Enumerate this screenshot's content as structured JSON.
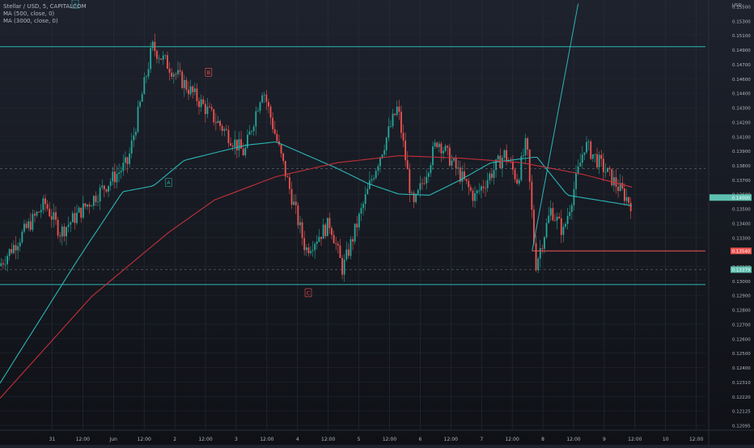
{
  "legend": {
    "symbol": "Stellar / USD, 5, CAPITALCOM",
    "ma1": "MA (500, close, 0)",
    "ma2": "MA (3000, close, 0)"
  },
  "flag_label": "1",
  "colors": {
    "up": "#26a69a",
    "down": "#ef5350",
    "ma500": "#2cb6b6",
    "ma3000": "#c2303a",
    "level": "#2cb6b6",
    "price_tag": "#5fbfb0",
    "bg": "#1e222d",
    "axis_text": "#b2b5be"
  },
  "chart_data": {
    "type": "candlestick",
    "title": "Stellar / USD, 5, CAPITALCOM",
    "ylabel": "USD",
    "ylim": [
      0.11995,
      0.15702
    ],
    "x_ticks": [
      "31",
      "12:00",
      "Jun",
      "12:00",
      "2",
      "12:00",
      "3",
      "12:00",
      "4",
      "12:00",
      "5",
      "12:00",
      "6",
      "12:00",
      "7",
      "12:00",
      "8",
      "12:00",
      "9",
      "12:00",
      "10",
      "12:00"
    ],
    "y_ticks": [
      "0.15500",
      "0.15300",
      "0.15100",
      "0.14900",
      "0.14700",
      "0.14600",
      "0.14400",
      "0.14300",
      "0.14200",
      "0.14100",
      "0.13900",
      "0.13800",
      "0.13700",
      "0.13600",
      "0.13500",
      "0.13400",
      "0.13300",
      "0.13200",
      "0.13100",
      "0.13000",
      "0.12900",
      "0.12800",
      "0.12700",
      "0.12600",
      "0.12500",
      "0.12400",
      "0.12310",
      "0.12220",
      "0.12125",
      "0.12095"
    ],
    "price_labels": [
      {
        "text": "0.13540",
        "value": 0.1354,
        "color": "#ef5350"
      },
      {
        "text": "0.13379",
        "value": 0.13379,
        "color": "#5fbfb0"
      },
      {
        "text": "0.14000",
        "value": 0.14,
        "color": "#5fbfb0"
      }
    ],
    "horizontal_levels": [
      0.153,
      0.1325
    ],
    "dashed_levels": [
      0.1425,
      0.1338
    ],
    "wave_labels": [
      {
        "text": "B",
        "color": "#ef5350"
      },
      {
        "text": "A",
        "color": "#26a69a"
      },
      {
        "text": "C",
        "color": "#ef5350"
      }
    ],
    "price_path_index": [
      0,
      1.5,
      2,
      4.2,
      5,
      8,
      8.6,
      10,
      10.8,
      11.2,
      12.2,
      13.0,
      13.5,
      14.3,
      15.5,
      16.5,
      16.9,
      17.2,
      17.5,
      18.0,
      18.4,
      19.1,
      20.6
    ],
    "price_path": [
      0.1341,
      0.1395,
      0.137,
      0.143,
      0.153,
      0.1438,
      0.1495,
      0.1355,
      0.1378,
      0.1338,
      0.142,
      0.1478,
      0.139,
      0.145,
      0.14,
      0.1438,
      0.1415,
      0.1448,
      0.1342,
      0.139,
      0.137,
      0.1446,
      0.1395
    ],
    "ma500_index": [
      0,
      2.5,
      4,
      5,
      6,
      8,
      9,
      11,
      12,
      13,
      14,
      15,
      16,
      17.5,
      18.5,
      20.6
    ],
    "ma500": [
      0.124,
      0.1345,
      0.1405,
      0.141,
      0.1432,
      0.1445,
      0.1448,
      0.1425,
      0.1412,
      0.1403,
      0.1402,
      0.1415,
      0.143,
      0.1435,
      0.1402,
      0.1393
    ],
    "ma3000_index": [
      0,
      3,
      5.5,
      7,
      9,
      11,
      13,
      15,
      17,
      19,
      20.6
    ],
    "ma3000": [
      0.1227,
      0.1315,
      0.137,
      0.1398,
      0.1418,
      0.143,
      0.1436,
      0.1434,
      0.143,
      0.142,
      0.1409
    ],
    "grid": true
  }
}
